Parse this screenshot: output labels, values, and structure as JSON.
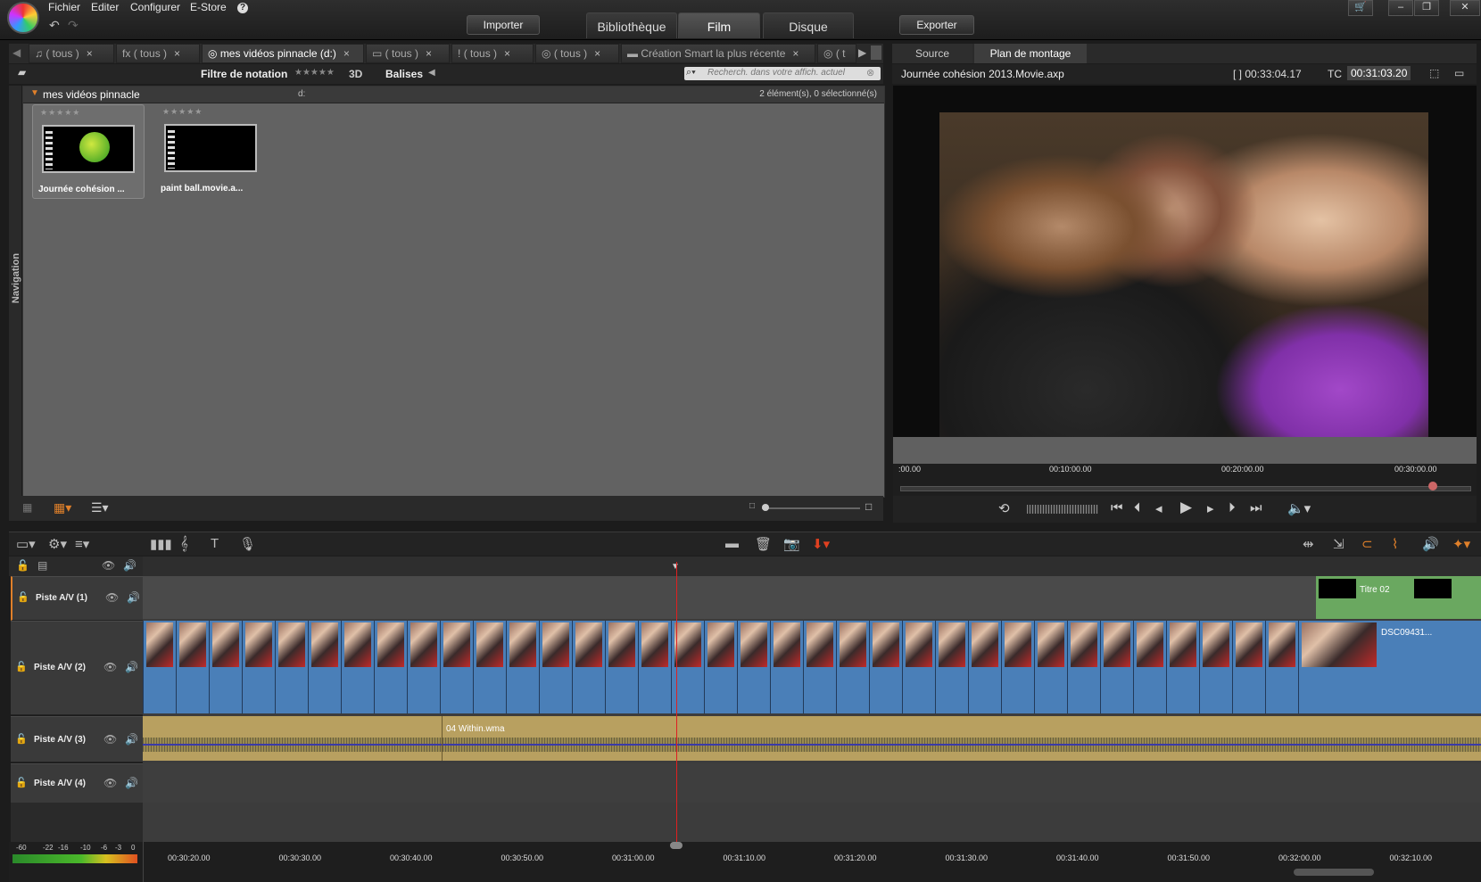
{
  "menu": {
    "file": "Fichier",
    "edit": "Editer",
    "configure": "Configurer",
    "estore": "E-Store",
    "help": "?"
  },
  "top_buttons": {
    "import": "Importer",
    "export": "Exporter"
  },
  "mode_tabs": [
    "Bibliothèque",
    "Film",
    "Disque"
  ],
  "active_mode": "Film",
  "library": {
    "tabs": [
      {
        "label": "( tous )",
        "icon": "audio-icon"
      },
      {
        "label": "( tous )",
        "icon": "fx-icon",
        "prefix": "fx"
      },
      {
        "label": "mes vidéos pinnacle (d:)",
        "icon": "disc-icon",
        "active": true
      },
      {
        "label": "( tous )",
        "icon": "photo-icon"
      },
      {
        "label": "( tous )",
        "icon": "exclamation-icon",
        "prefix": "!"
      },
      {
        "label": "( tous )",
        "icon": "disc-icon"
      },
      {
        "label": "Création Smart la plus récente",
        "icon": "folder-icon"
      },
      {
        "label": "( t",
        "icon": "disc-icon"
      }
    ],
    "filter_label": "Filtre de notation",
    "filter_stars": "★★★★★",
    "3d_label": "3D",
    "tags_label": "Balises",
    "search_placeholder": "Recherch. dans votre affich. actuel",
    "folder_name": "mes vidéos pinnacle",
    "folder_drive": "d:",
    "folder_count": "2 élément(s), 0 sélectionné(s)",
    "nav_label": "Navigation",
    "items": [
      {
        "label": "Journée cohésion ...",
        "stars": "★★★★★"
      },
      {
        "label": "paint ball.movie.a...",
        "stars": "★★★★★"
      }
    ]
  },
  "preview": {
    "tabs": [
      "Source",
      "Plan de montage"
    ],
    "active_tab": "Plan de montage",
    "file": "Journée cohésion 2013.Movie.axp",
    "duration": "[ ] 00:33:04.17",
    "tc_label": "TC",
    "tc_value": "00:31:03.20",
    "timeline_ticks": [
      ":00.00",
      "00:10:00.00",
      "00:20:00.00",
      "00:30:00.00"
    ]
  },
  "timeline": {
    "tracks": [
      {
        "name": "Piste A/V (1)"
      },
      {
        "name": "Piste A/V (2)"
      },
      {
        "name": "Piste A/V (3)"
      },
      {
        "name": "Piste A/V (4)"
      }
    ],
    "title_clip": "Titre 02",
    "last_clip": "DSC09431...",
    "audio_clip": "04 Within.wma",
    "ruler": [
      "00:30:20.00",
      "00:30:30.00",
      "00:30:40.00",
      "00:30:50.00",
      "00:31:00.00",
      "00:31:10.00",
      "00:31:20.00",
      "00:31:30.00",
      "00:31:40.00",
      "00:31:50.00",
      "00:32:00.00",
      "00:32:10.00"
    ],
    "meter_labels": [
      "-60",
      "-22",
      "-16",
      "-10",
      "-6",
      "-3",
      "0"
    ]
  }
}
